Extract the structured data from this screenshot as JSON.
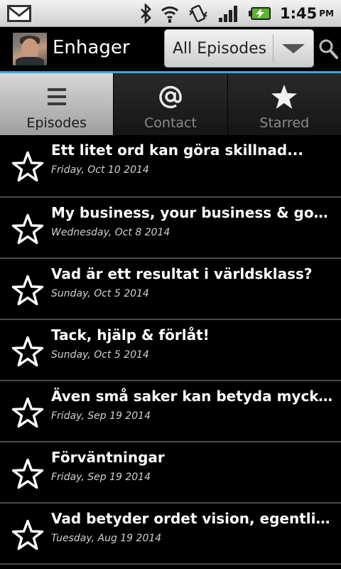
{
  "status_bar": {
    "time": "1:45",
    "ampm": "PM",
    "icons": [
      "gmail-icon",
      "bluetooth-icon",
      "wifi-icon",
      "vibrate-icon",
      "signal-icon",
      "battery-charging-icon"
    ]
  },
  "action_bar": {
    "title": "Enhager",
    "spinner_value": "All Episodes",
    "accent_color": "#3aa4d8"
  },
  "tabs": [
    {
      "label": "Episodes",
      "icon": "menu-lines-icon",
      "active": true
    },
    {
      "label": "Contact",
      "icon": "at-sign-icon",
      "active": false
    },
    {
      "label": "Starred",
      "icon": "star-icon",
      "active": false
    }
  ],
  "episodes": [
    {
      "title": "Ett litet ord kan göra skillnad...",
      "date": "Friday, Oct 10 2014"
    },
    {
      "title": "My business, your business & god's bu...",
      "date": "Wednesday, Oct 8 2014"
    },
    {
      "title": "Vad är ett resultat i världsklass?",
      "date": "Sunday, Oct 5 2014"
    },
    {
      "title": "Tack, hjälp & förlåt!",
      "date": "Sunday, Oct 5 2014"
    },
    {
      "title": "Även små saker kan betyda mycket...",
      "date": "Friday, Sep 19 2014"
    },
    {
      "title": "Förväntningar",
      "date": "Friday, Sep 19 2014"
    },
    {
      "title": "Vad betyder ordet vision, egentligen?",
      "date": "Tuesday, Aug 19 2014"
    }
  ]
}
